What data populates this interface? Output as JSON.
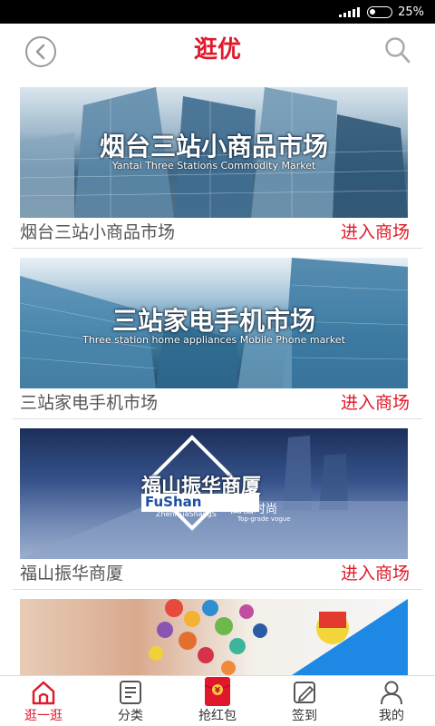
{
  "status": {
    "battery": "25%"
  },
  "header": {
    "title": "逛优"
  },
  "stores": [
    {
      "name": "烟台三站小商品市场",
      "action": "进入商场",
      "banner_title": "烟台三站小商品市场",
      "banner_sub": "Yantai Three Stations Commodity Market"
    },
    {
      "name": "三站家电手机市场",
      "action": "进入商场",
      "banner_title": "三站家电手机市场",
      "banner_sub": "Three station home appliances  Mobile Phone market"
    },
    {
      "name": "福山振华商厦",
      "action": "进入商场",
      "banner_title": "福山振华商厦",
      "banner_sub1": "FuShan",
      "banner_sub2": "ZhenHuaShangS",
      "banner_sub3": "高档时尚",
      "banner_sub4": "Top-grade  vogue"
    }
  ],
  "tabbar": [
    {
      "label": "逛一逛",
      "icon": "home-icon",
      "active": true
    },
    {
      "label": "分类",
      "icon": "category-icon",
      "active": false
    },
    {
      "label": "抢红包",
      "icon": "red-envelope-icon",
      "active": false
    },
    {
      "label": "签到",
      "icon": "checkin-icon",
      "active": false
    },
    {
      "label": "我的",
      "icon": "profile-icon",
      "active": false
    }
  ]
}
